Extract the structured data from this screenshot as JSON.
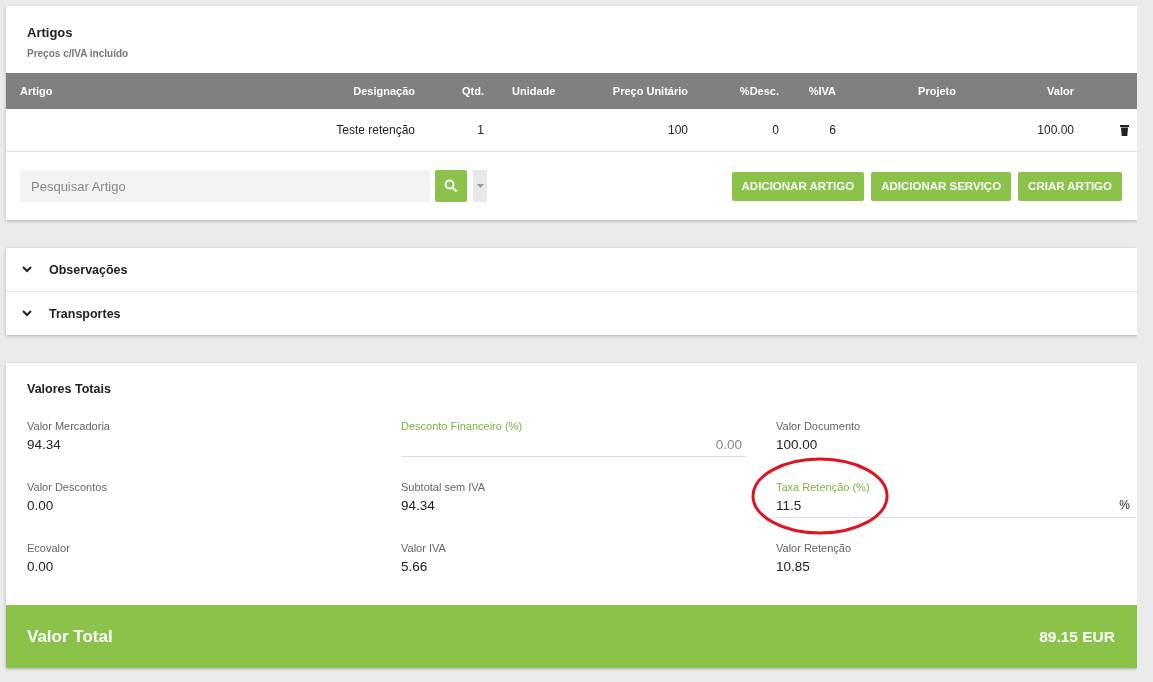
{
  "articles": {
    "title": "Artigos",
    "subtitle": "Preços c/IVA incluído",
    "columns": [
      "Artigo",
      "Designação",
      "Qtd.",
      "Unidade",
      "Preço Unitário",
      "%Desc.",
      "%IVA",
      "Projeto",
      "Valor"
    ],
    "rows": [
      {
        "cells": [
          "",
          "Teste retenção",
          "1",
          "",
          "100",
          "0",
          "6",
          "",
          "100.00"
        ]
      }
    ],
    "search": {
      "placeholder": "Pesquisar Artigo"
    },
    "buttons": [
      "ADICIONAR ARTIGO",
      "ADICIONAR SERVIÇO",
      "CRIAR ARTIGO"
    ]
  },
  "sections": [
    {
      "label": "Observações",
      "expanded": false
    },
    {
      "label": "Transportes",
      "expanded": false
    }
  ],
  "totals": {
    "title": "Valores Totais",
    "fields": [
      {
        "label": "Valor Mercadoria",
        "value": "94.34",
        "kind": "display",
        "annotated": false
      },
      {
        "label": "Desconto Financeiro (%)",
        "value": "0.00",
        "kind": "input",
        "annotated": false
      },
      {
        "label": "Valor Documento",
        "value": "100.00",
        "kind": "display",
        "annotated": false
      },
      {
        "label": "Valor Descontos",
        "value": "0.00",
        "kind": "display",
        "annotated": false
      },
      {
        "label": "Subtotal sem IVA",
        "value": "94.34",
        "kind": "display",
        "annotated": false
      },
      {
        "label": "Taxa Retenção (%)",
        "value": "11.5",
        "kind": "input",
        "suffix": "%",
        "annotated": true
      },
      {
        "label": "Ecovalor",
        "value": "0.00",
        "kind": "display",
        "annotated": false
      },
      {
        "label": "Valor IVA",
        "value": "5.66",
        "kind": "display",
        "annotated": false
      },
      {
        "label": "Valor Retenção",
        "value": "10.85",
        "kind": "display",
        "annotated": false
      }
    ],
    "total_label": "Valor Total",
    "total_value": "89.15 EUR"
  }
}
